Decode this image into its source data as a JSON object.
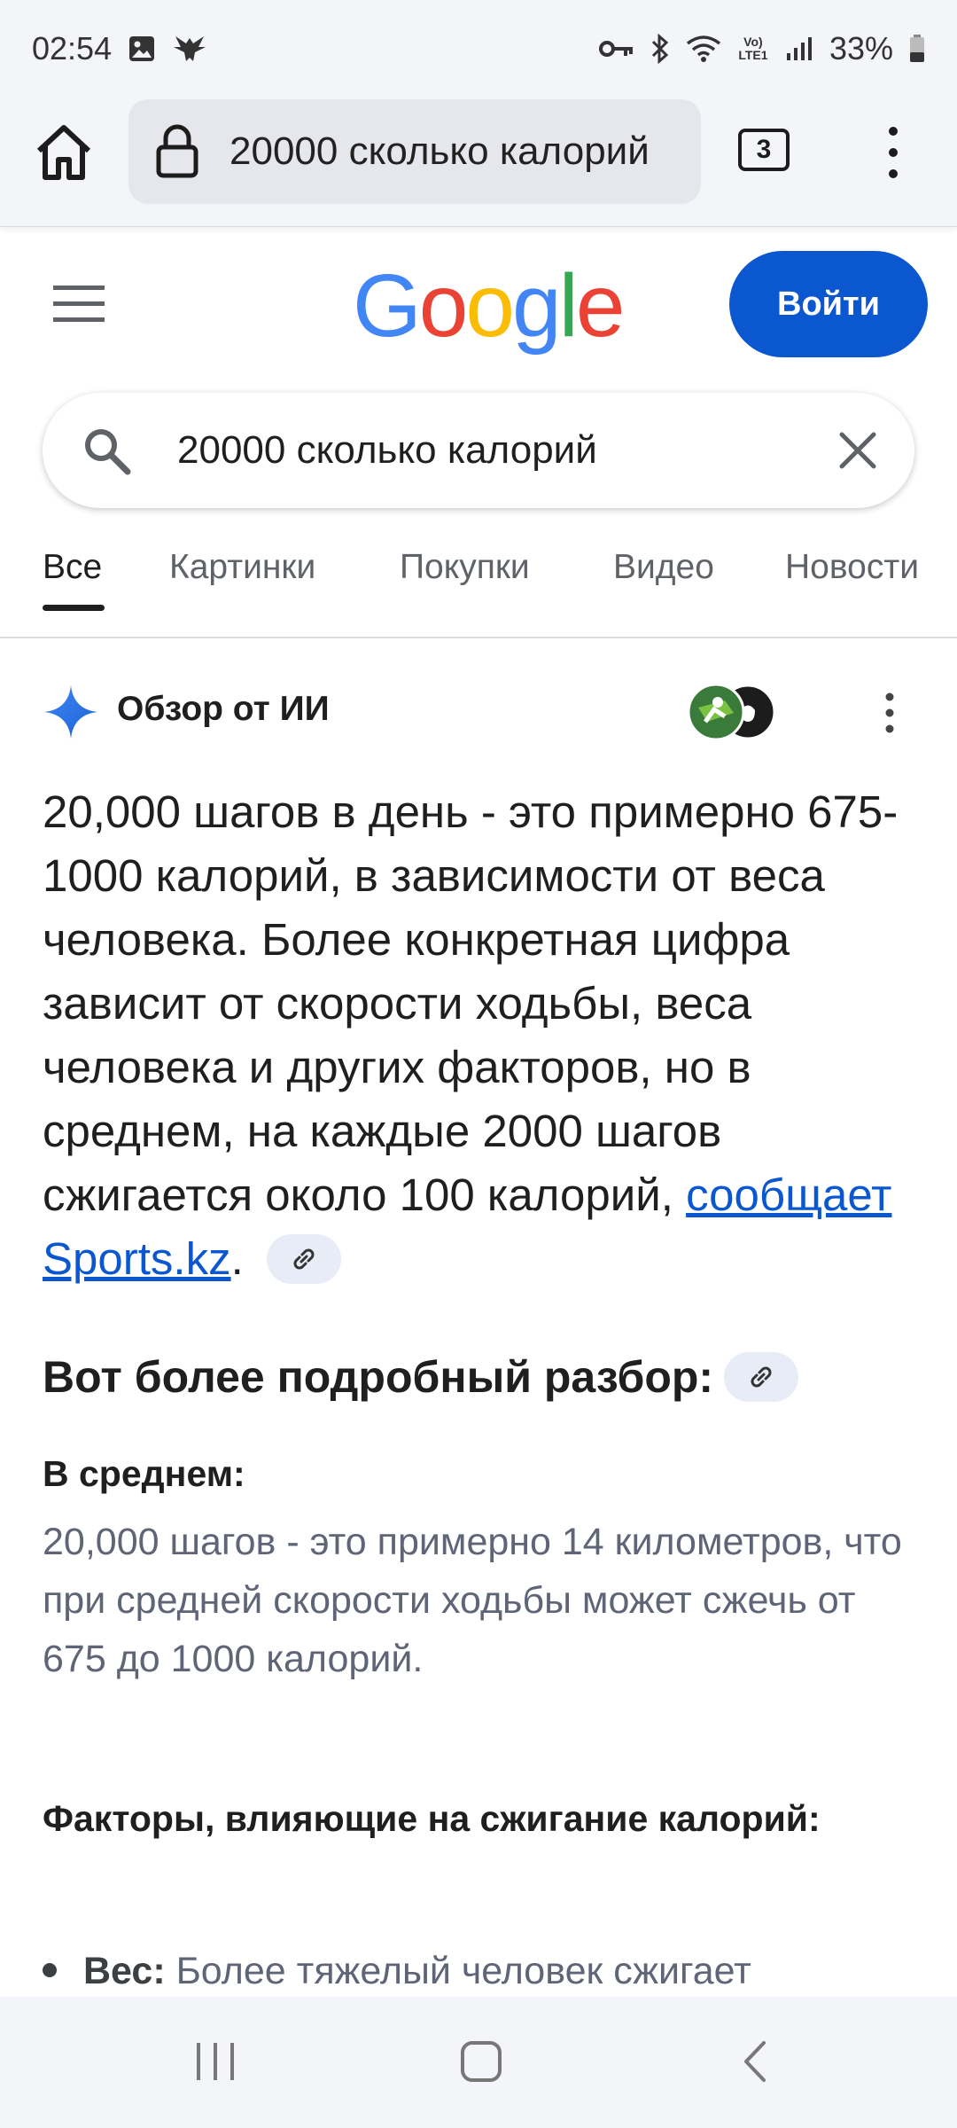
{
  "status_bar": {
    "time": "02:54",
    "battery": "33%",
    "network_label": "Vo) LTE1"
  },
  "browser": {
    "url_text": "20000 сколько калорий",
    "tab_count": "3"
  },
  "header": {
    "logo_letters": [
      "G",
      "o",
      "o",
      "g",
      "l",
      "e"
    ],
    "logo_colors": [
      "#4285F4",
      "#EA4335",
      "#FBBC05",
      "#4285F4",
      "#34A853",
      "#EA4335"
    ],
    "signin_label": "Войти",
    "signin_color": "#0b57d0"
  },
  "search": {
    "query": "20000 сколько калорий"
  },
  "tabs": [
    {
      "label": "Все",
      "active": true
    },
    {
      "label": "Картинки",
      "active": false
    },
    {
      "label": "Покупки",
      "active": false
    },
    {
      "label": "Видео",
      "active": false
    },
    {
      "label": "Новости",
      "active": false
    }
  ],
  "ai_overview": {
    "title": "Обзор от ИИ",
    "paragraph": "20,000 шагов в день - это примерно 675-1000 калорий, в зависимости от веса человека. Более конкретная цифра зависит от скорости ходьбы, веса человека и других факторов, но в среднем, на каждые 2000 шагов сжигается около 100 калорий, ",
    "source_link": "сообщает Sports.kz",
    "link_color": "#0b57d0",
    "breakdown_heading": "Вот более подробный разбор:",
    "avg_heading": "В среднем:",
    "avg_text": "20,000 шагов - это примерно 14 километров, что при средней скорости ходьбы может сжечь от 675 до 1000 калорий.",
    "factors_heading": "Факторы, влияющие на сжигание калорий:",
    "bullet_label": "Вес:",
    "bullet_text": " Более тяжелый человек сжигает"
  },
  "nav": {
    "icons": [
      "recent-apps-icon",
      "home-icon",
      "back-icon"
    ]
  }
}
